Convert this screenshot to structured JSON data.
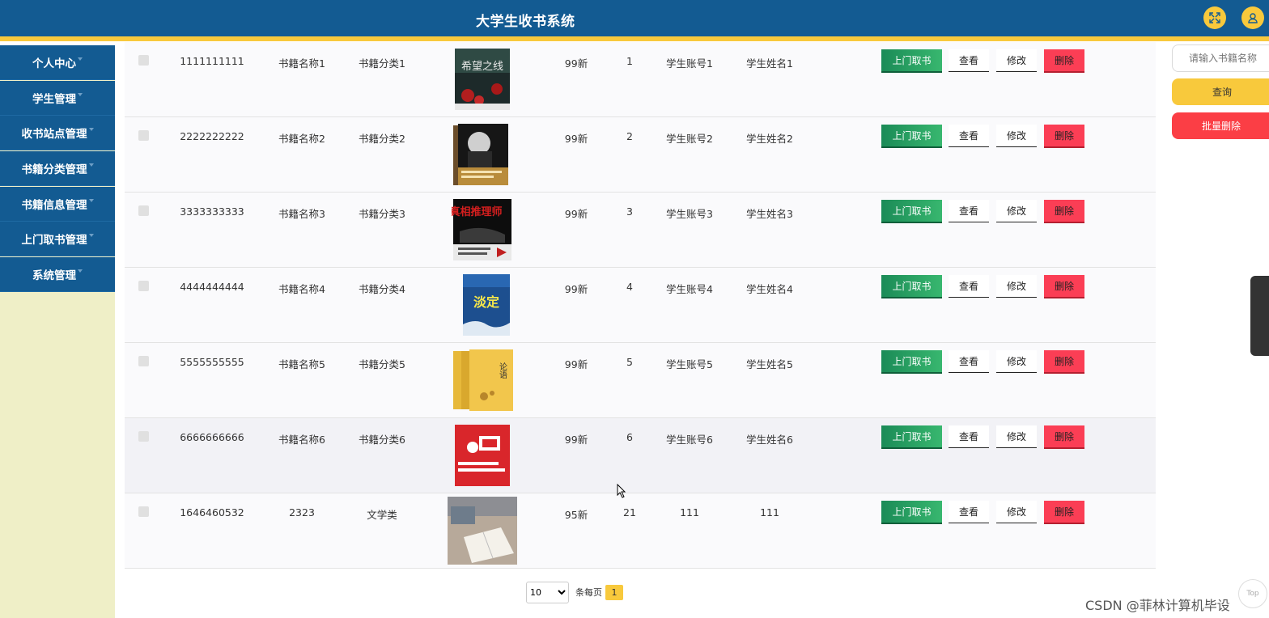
{
  "app": {
    "title": "大学生收书系统"
  },
  "header": {
    "fullscreen_icon": "expand-icon",
    "user_icon": "user-icon"
  },
  "sidebar": {
    "items": [
      {
        "label": "个人中心"
      },
      {
        "label": "学生管理"
      },
      {
        "label": "收书站点管理"
      },
      {
        "label": "书籍分类管理"
      },
      {
        "label": "书籍信息管理"
      },
      {
        "label": "上门取书管理"
      },
      {
        "label": "系统管理"
      }
    ]
  },
  "search": {
    "placeholder": "请输入书籍名称",
    "query_label": "查询",
    "batch_delete_label": "批量删除"
  },
  "actions": {
    "pickup": "上门取书",
    "view": "查看",
    "edit": "修改",
    "delete": "删除"
  },
  "rows": [
    {
      "number": "1111111111",
      "name": "书籍名称1",
      "category": "书籍分类1",
      "condition": "99新",
      "qty": "1",
      "account": "学生账号1",
      "student": "学生姓名1",
      "cover_title": "希望之线"
    },
    {
      "number": "2222222222",
      "name": "书籍名称2",
      "category": "书籍分类2",
      "condition": "99新",
      "qty": "2",
      "account": "学生账号2",
      "student": "学生姓名2",
      "cover_title": ""
    },
    {
      "number": "3333333333",
      "name": "书籍名称3",
      "category": "书籍分类3",
      "condition": "99新",
      "qty": "3",
      "account": "学生账号3",
      "student": "学生姓名3",
      "cover_title": "真相推理师"
    },
    {
      "number": "4444444444",
      "name": "书籍名称4",
      "category": "书籍分类4",
      "condition": "99新",
      "qty": "4",
      "account": "学生账号4",
      "student": "学生姓名4",
      "cover_title": "淡定"
    },
    {
      "number": "5555555555",
      "name": "书籍名称5",
      "category": "书籍分类5",
      "condition": "99新",
      "qty": "5",
      "account": "学生账号5",
      "student": "学生姓名5",
      "cover_title": "论语"
    },
    {
      "number": "6666666666",
      "name": "书籍名称6",
      "category": "书籍分类6",
      "condition": "99新",
      "qty": "6",
      "account": "学生账号6",
      "student": "学生姓名6",
      "cover_title": ""
    },
    {
      "number": "1646460532",
      "name": "2323",
      "category": "文学类",
      "condition": "95新",
      "qty": "21",
      "account": "111",
      "student": "111",
      "cover_title": ""
    }
  ],
  "pagination": {
    "page_size": "10",
    "per_page_label": "条每页",
    "current_page": "1"
  },
  "watermark": "CSDN @菲林计算机毕设",
  "scroll_top_label": "Top",
  "colors": {
    "header": "#135b92",
    "accent": "#f8c93c",
    "sidebar_bg": "#efefc7",
    "danger": "#fb3e45",
    "success": "#1b8b57"
  }
}
